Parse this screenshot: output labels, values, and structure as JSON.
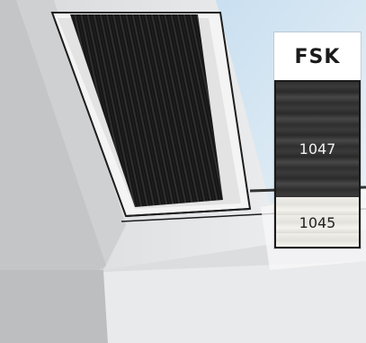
{
  "product": {
    "title": "FSK",
    "swatches": [
      {
        "code": "1047",
        "shade": "dark"
      },
      {
        "code": "1045",
        "shade": "light"
      }
    ]
  }
}
